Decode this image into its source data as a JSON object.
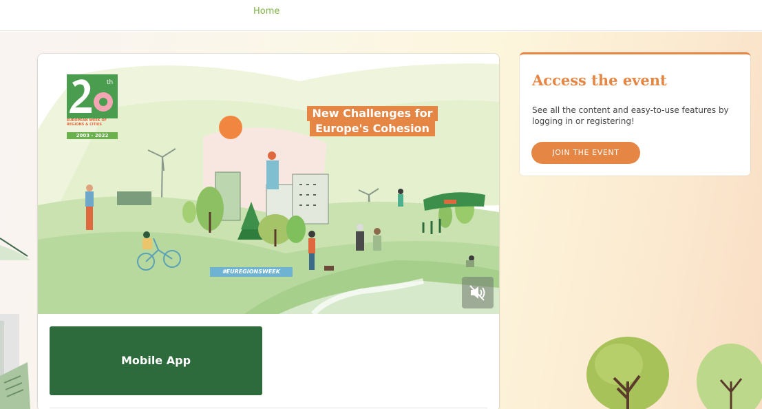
{
  "nav": {
    "home_label": "Home"
  },
  "hero": {
    "logo": {
      "number": "20",
      "superscript": "th",
      "title": "EUROPEAN WEEK OF REGIONS & CITIES",
      "years": "2003 - 2022"
    },
    "headline_line1": "New Challenges for",
    "headline_line2": "Europe's Cohesion",
    "hashtag": "#EUREGIONSWEEK",
    "mute_icon": "speaker-muted-icon",
    "mobile_app_label": "Mobile App"
  },
  "access": {
    "title": "Access the event",
    "description": "See all the content and easy-to-use features by logging in or registering!",
    "join_label": "JOIN THE EVENT"
  },
  "colors": {
    "accent_orange": "#e58645",
    "nav_green": "#7cb342",
    "mobile_app_green": "#2e6b3c"
  }
}
